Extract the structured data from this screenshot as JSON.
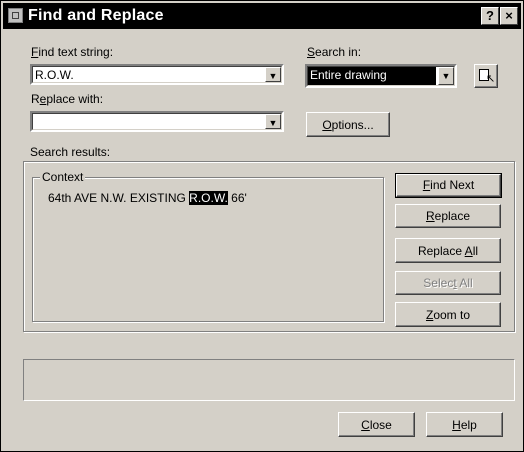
{
  "window": {
    "title": "Find and Replace",
    "help_glyph": "?",
    "close_glyph": "×"
  },
  "find": {
    "label_pre": "",
    "label_accel": "F",
    "label_post": "ind text string:",
    "value": "R.O.W."
  },
  "replace_with": {
    "label_pre": "R",
    "label_accel": "e",
    "label_post": "place with:",
    "value": ""
  },
  "search_in": {
    "label_pre": "",
    "label_accel": "S",
    "label_post": "earch in:",
    "value": "Entire drawing"
  },
  "buttons": {
    "options": {
      "pre": "",
      "accel": "O",
      "post": "ptions..."
    },
    "find_next": {
      "pre": "",
      "accel": "F",
      "post": "ind Next"
    },
    "replace": {
      "pre": "",
      "accel": "R",
      "post": "eplace"
    },
    "replace_all": {
      "pre": "Replace ",
      "accel": "A",
      "post": "ll"
    },
    "select_all": {
      "pre": "Selec",
      "accel": "t",
      "post": " All"
    },
    "zoom_to": {
      "pre": "",
      "accel": "Z",
      "post": "oom to"
    },
    "close": {
      "pre": "",
      "accel": "C",
      "post": "lose"
    },
    "help": {
      "pre": "",
      "accel": "H",
      "post": "elp"
    }
  },
  "search_results": {
    "label": "Search results:",
    "context_label": "Context",
    "row": {
      "before": "64th AVE N.W. EXISTING ",
      "match": "R.O.W.",
      "after": " 66'"
    }
  },
  "icons": {
    "combo_arrow": "▼",
    "app": "app-icon",
    "select_objects": "select-objects-icon"
  }
}
